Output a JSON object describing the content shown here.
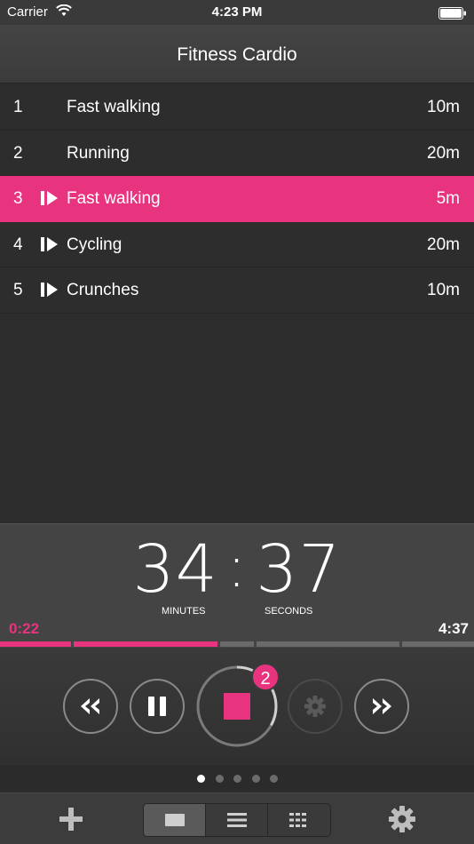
{
  "status_bar": {
    "carrier": "Carrier",
    "time": "4:23 PM"
  },
  "nav": {
    "title": "Fitness Cardio"
  },
  "workouts": [
    {
      "num": "1",
      "name": "Fast walking",
      "duration": "10m",
      "has_icon": false,
      "active": false
    },
    {
      "num": "2",
      "name": "Running",
      "duration": "20m",
      "has_icon": false,
      "active": false
    },
    {
      "num": "3",
      "name": "Fast walking",
      "duration": "5m",
      "has_icon": true,
      "active": true
    },
    {
      "num": "4",
      "name": "Cycling",
      "duration": "20m",
      "has_icon": true,
      "active": false
    },
    {
      "num": "5",
      "name": "Crunches",
      "duration": "10m",
      "has_icon": true,
      "active": false
    }
  ],
  "timer": {
    "minutes": "34",
    "seconds": "37",
    "minutes_label": "MINUTES",
    "seconds_label": "SECONDS",
    "elapsed": "0:22",
    "remaining": "4:37"
  },
  "progress_segments": [
    {
      "fill": 1.0
    },
    {
      "fill": 1.0
    },
    {
      "fill": 0.0
    },
    {
      "fill": 0.0
    },
    {
      "fill": 0.0
    }
  ],
  "controls": {
    "badge": "2",
    "stop_progress": 0.33
  },
  "icons": {
    "rewind": "rewind-icon",
    "pause": "pause-icon",
    "stop": "stop-icon",
    "gear": "gear-icon",
    "fast_forward": "fast-forward-icon",
    "add": "plus-icon",
    "settings": "settings-icon"
  },
  "colors": {
    "accent": "#e8337f",
    "background": "#2d2d2d"
  },
  "page_dots": {
    "count": 5,
    "active": 0
  },
  "view_modes": {
    "selected": 0
  }
}
